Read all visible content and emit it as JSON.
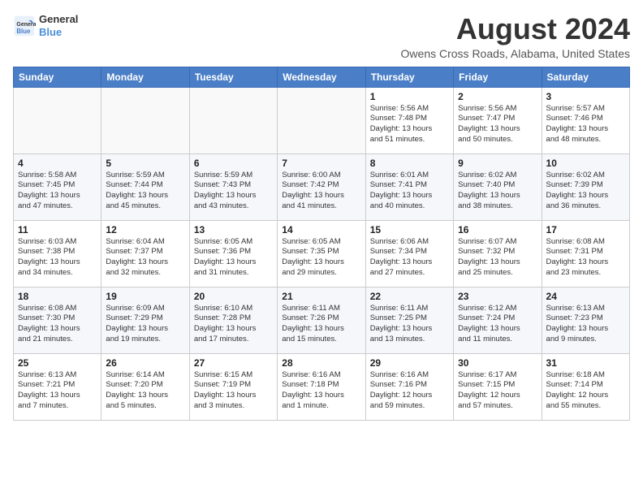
{
  "header": {
    "logo_line1": "General",
    "logo_line2": "Blue",
    "title": "August 2024",
    "location": "Owens Cross Roads, Alabama, United States"
  },
  "days_of_week": [
    "Sunday",
    "Monday",
    "Tuesday",
    "Wednesday",
    "Thursday",
    "Friday",
    "Saturday"
  ],
  "weeks": [
    [
      {
        "day": "",
        "info": ""
      },
      {
        "day": "",
        "info": ""
      },
      {
        "day": "",
        "info": ""
      },
      {
        "day": "",
        "info": ""
      },
      {
        "day": "1",
        "info": "Sunrise: 5:56 AM\nSunset: 7:48 PM\nDaylight: 13 hours\nand 51 minutes."
      },
      {
        "day": "2",
        "info": "Sunrise: 5:56 AM\nSunset: 7:47 PM\nDaylight: 13 hours\nand 50 minutes."
      },
      {
        "day": "3",
        "info": "Sunrise: 5:57 AM\nSunset: 7:46 PM\nDaylight: 13 hours\nand 48 minutes."
      }
    ],
    [
      {
        "day": "4",
        "info": "Sunrise: 5:58 AM\nSunset: 7:45 PM\nDaylight: 13 hours\nand 47 minutes."
      },
      {
        "day": "5",
        "info": "Sunrise: 5:59 AM\nSunset: 7:44 PM\nDaylight: 13 hours\nand 45 minutes."
      },
      {
        "day": "6",
        "info": "Sunrise: 5:59 AM\nSunset: 7:43 PM\nDaylight: 13 hours\nand 43 minutes."
      },
      {
        "day": "7",
        "info": "Sunrise: 6:00 AM\nSunset: 7:42 PM\nDaylight: 13 hours\nand 41 minutes."
      },
      {
        "day": "8",
        "info": "Sunrise: 6:01 AM\nSunset: 7:41 PM\nDaylight: 13 hours\nand 40 minutes."
      },
      {
        "day": "9",
        "info": "Sunrise: 6:02 AM\nSunset: 7:40 PM\nDaylight: 13 hours\nand 38 minutes."
      },
      {
        "day": "10",
        "info": "Sunrise: 6:02 AM\nSunset: 7:39 PM\nDaylight: 13 hours\nand 36 minutes."
      }
    ],
    [
      {
        "day": "11",
        "info": "Sunrise: 6:03 AM\nSunset: 7:38 PM\nDaylight: 13 hours\nand 34 minutes."
      },
      {
        "day": "12",
        "info": "Sunrise: 6:04 AM\nSunset: 7:37 PM\nDaylight: 13 hours\nand 32 minutes."
      },
      {
        "day": "13",
        "info": "Sunrise: 6:05 AM\nSunset: 7:36 PM\nDaylight: 13 hours\nand 31 minutes."
      },
      {
        "day": "14",
        "info": "Sunrise: 6:05 AM\nSunset: 7:35 PM\nDaylight: 13 hours\nand 29 minutes."
      },
      {
        "day": "15",
        "info": "Sunrise: 6:06 AM\nSunset: 7:34 PM\nDaylight: 13 hours\nand 27 minutes."
      },
      {
        "day": "16",
        "info": "Sunrise: 6:07 AM\nSunset: 7:32 PM\nDaylight: 13 hours\nand 25 minutes."
      },
      {
        "day": "17",
        "info": "Sunrise: 6:08 AM\nSunset: 7:31 PM\nDaylight: 13 hours\nand 23 minutes."
      }
    ],
    [
      {
        "day": "18",
        "info": "Sunrise: 6:08 AM\nSunset: 7:30 PM\nDaylight: 13 hours\nand 21 minutes."
      },
      {
        "day": "19",
        "info": "Sunrise: 6:09 AM\nSunset: 7:29 PM\nDaylight: 13 hours\nand 19 minutes."
      },
      {
        "day": "20",
        "info": "Sunrise: 6:10 AM\nSunset: 7:28 PM\nDaylight: 13 hours\nand 17 minutes."
      },
      {
        "day": "21",
        "info": "Sunrise: 6:11 AM\nSunset: 7:26 PM\nDaylight: 13 hours\nand 15 minutes."
      },
      {
        "day": "22",
        "info": "Sunrise: 6:11 AM\nSunset: 7:25 PM\nDaylight: 13 hours\nand 13 minutes."
      },
      {
        "day": "23",
        "info": "Sunrise: 6:12 AM\nSunset: 7:24 PM\nDaylight: 13 hours\nand 11 minutes."
      },
      {
        "day": "24",
        "info": "Sunrise: 6:13 AM\nSunset: 7:23 PM\nDaylight: 13 hours\nand 9 minutes."
      }
    ],
    [
      {
        "day": "25",
        "info": "Sunrise: 6:13 AM\nSunset: 7:21 PM\nDaylight: 13 hours\nand 7 minutes."
      },
      {
        "day": "26",
        "info": "Sunrise: 6:14 AM\nSunset: 7:20 PM\nDaylight: 13 hours\nand 5 minutes."
      },
      {
        "day": "27",
        "info": "Sunrise: 6:15 AM\nSunset: 7:19 PM\nDaylight: 13 hours\nand 3 minutes."
      },
      {
        "day": "28",
        "info": "Sunrise: 6:16 AM\nSunset: 7:18 PM\nDaylight: 13 hours\nand 1 minute."
      },
      {
        "day": "29",
        "info": "Sunrise: 6:16 AM\nSunset: 7:16 PM\nDaylight: 12 hours\nand 59 minutes."
      },
      {
        "day": "30",
        "info": "Sunrise: 6:17 AM\nSunset: 7:15 PM\nDaylight: 12 hours\nand 57 minutes."
      },
      {
        "day": "31",
        "info": "Sunrise: 6:18 AM\nSunset: 7:14 PM\nDaylight: 12 hours\nand 55 minutes."
      }
    ]
  ]
}
